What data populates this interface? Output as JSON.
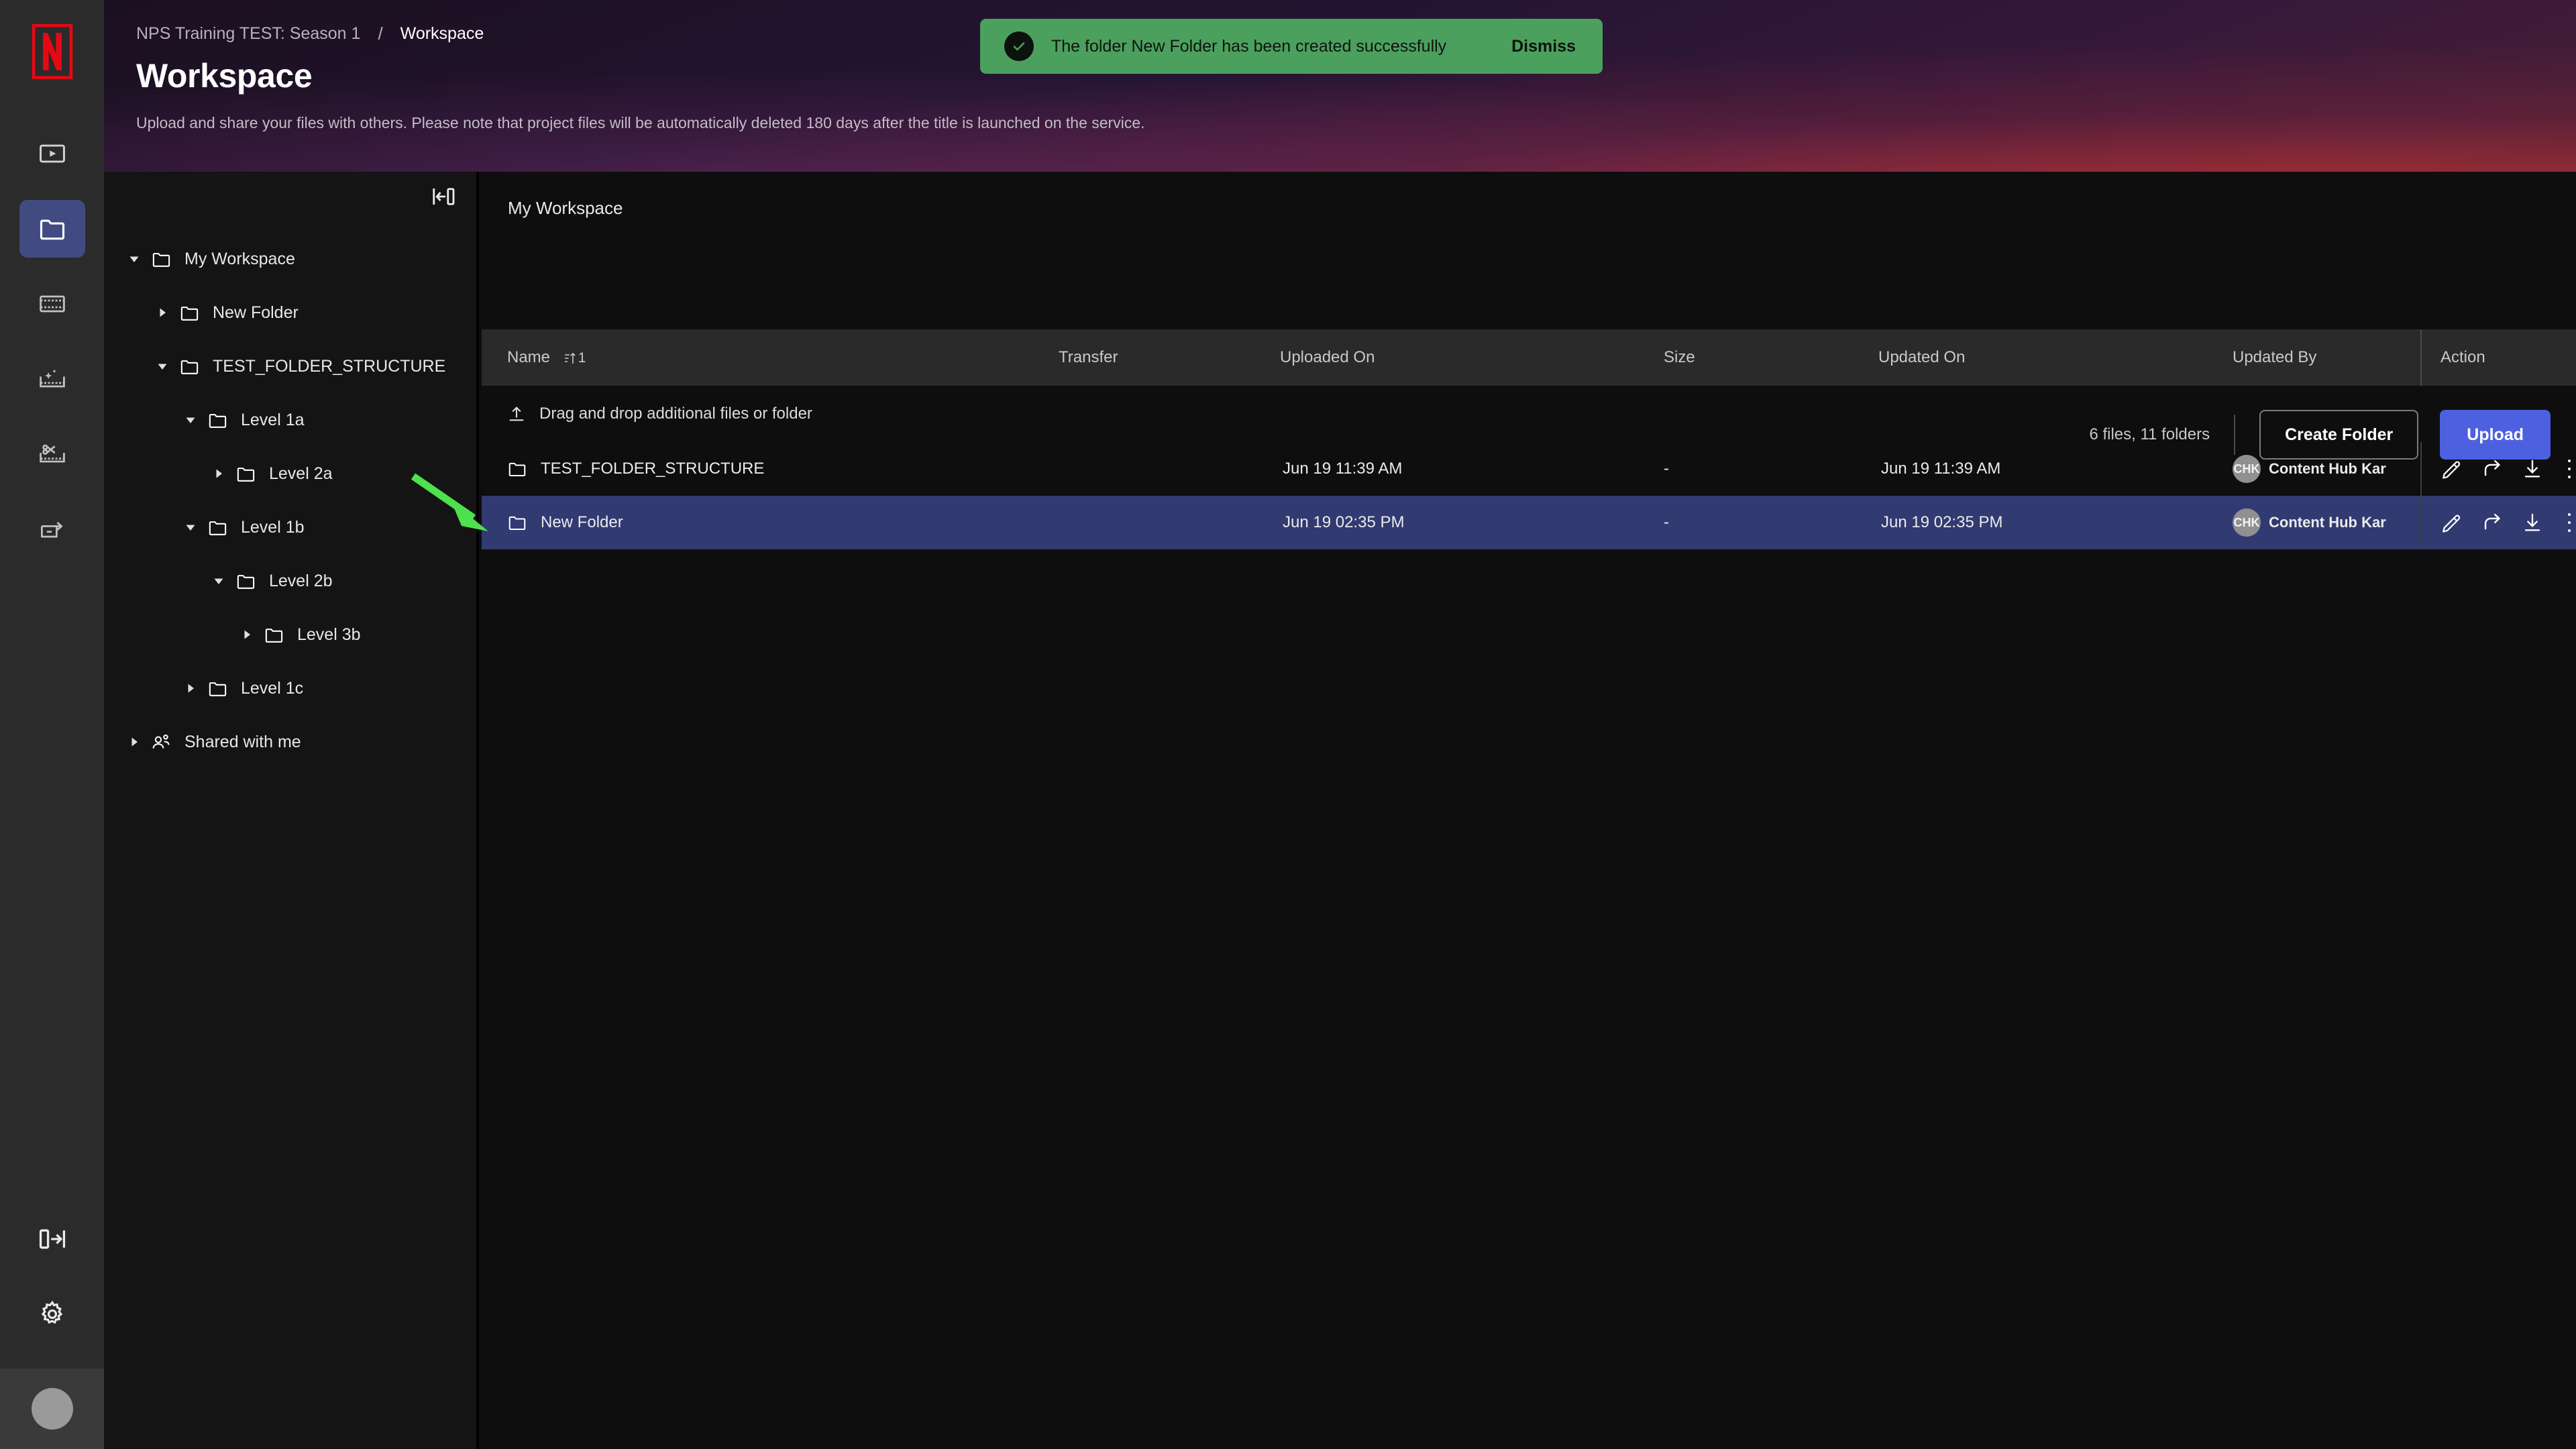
{
  "nav_rail": {
    "logo": "netflix-n-logo",
    "items": [
      {
        "name": "player",
        "icon": "player-icon",
        "active": false
      },
      {
        "name": "workspace",
        "icon": "folder-icon",
        "active": true
      },
      {
        "name": "assets",
        "icon": "film-strip-icon",
        "active": false
      },
      {
        "name": "vfx",
        "icon": "film-sparkle-icon",
        "active": false
      },
      {
        "name": "editorial",
        "icon": "film-scissors-icon",
        "active": false
      },
      {
        "name": "delivery",
        "icon": "box-arrow-icon",
        "active": false
      }
    ],
    "expand_label": "expand-sidebar",
    "settings_label": "settings",
    "avatar_label": "user-avatar"
  },
  "header": {
    "breadcrumb_project": "NPS Training TEST: Season 1",
    "breadcrumb_separator": "/",
    "breadcrumb_current": "Workspace",
    "title": "Workspace",
    "subtitle": "Upload and share your files with others. Please note that project files will be automatically deleted 180 days after the title is launched on the service."
  },
  "toast": {
    "message": "The folder New Folder has been created successfully",
    "dismiss_label": "Dismiss",
    "color": "#4ba05d",
    "icon": "check-circle-icon"
  },
  "tree": {
    "collapse_icon": "collapse-panel-icon",
    "items": [
      {
        "label": "My Workspace",
        "depth": 0,
        "expanded": true,
        "icon": "folder-icon",
        "caret": "down"
      },
      {
        "label": "New Folder",
        "depth": 1,
        "expanded": false,
        "icon": "folder-icon",
        "caret": "right"
      },
      {
        "label": "TEST_FOLDER_STRUCTURE",
        "depth": 1,
        "expanded": true,
        "icon": "folder-icon",
        "caret": "down"
      },
      {
        "label": "Level 1a",
        "depth": 2,
        "expanded": true,
        "icon": "folder-icon",
        "caret": "down"
      },
      {
        "label": "Level 2a",
        "depth": 3,
        "expanded": false,
        "icon": "folder-icon",
        "caret": "right"
      },
      {
        "label": "Level 1b",
        "depth": 2,
        "expanded": true,
        "icon": "folder-icon",
        "caret": "down"
      },
      {
        "label": "Level 2b",
        "depth": 3,
        "expanded": true,
        "icon": "folder-icon",
        "caret": "down"
      },
      {
        "label": "Level 3b",
        "depth": 4,
        "expanded": false,
        "icon": "folder-icon",
        "caret": "right"
      },
      {
        "label": "Level 1c",
        "depth": 2,
        "expanded": false,
        "icon": "folder-icon",
        "caret": "right"
      },
      {
        "label": "Shared with me",
        "depth": 0,
        "expanded": false,
        "icon": "people-icon",
        "caret": "right"
      }
    ]
  },
  "main": {
    "title": "My Workspace",
    "file_count": "6 files, 11 folders",
    "create_folder_label": "Create Folder",
    "upload_label": "Upload",
    "upload_color": "#4d61e0",
    "dropzone_label": "Drag and drop additional files or folder",
    "columns": {
      "name": "Name",
      "sort_order": "1",
      "transfer": "Transfer",
      "uploaded_on": "Uploaded On",
      "size": "Size",
      "updated_on": "Updated On",
      "updated_by": "Updated By",
      "action": "Action"
    },
    "rows": [
      {
        "name": "TEST_FOLDER_STRUCTURE",
        "icon": "folder-icon",
        "transfer": "",
        "uploaded_on": "Jun 19 11:39 AM",
        "size": "-",
        "updated_on": "Jun 19 11:39 AM",
        "updated_by_initials": "CHK",
        "updated_by": "Content Hub Kar",
        "selected": false
      },
      {
        "name": "New Folder",
        "icon": "folder-icon",
        "transfer": "",
        "uploaded_on": "Jun 19 02:35 PM",
        "size": "-",
        "updated_on": "Jun 19 02:35 PM",
        "updated_by_initials": "CHK",
        "updated_by": "Content Hub Kar",
        "selected": true
      }
    ],
    "row_actions": [
      {
        "name": "edit-icon",
        "label": "Edit"
      },
      {
        "name": "share-icon",
        "label": "Share"
      },
      {
        "name": "download-icon",
        "label": "Download"
      },
      {
        "name": "more-icon",
        "label": "More"
      }
    ],
    "selected_row_color": "#323a72"
  },
  "annotation": {
    "arrow_color": "#4ee04e",
    "points_to": "New Folder row"
  }
}
